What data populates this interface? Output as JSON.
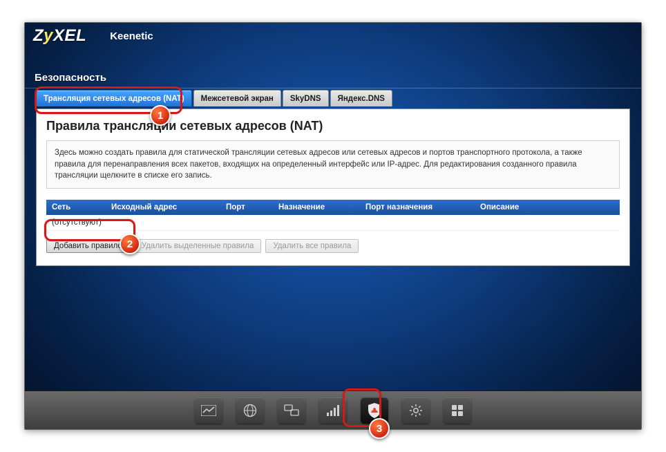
{
  "brand": {
    "prefix": "Z",
    "highlight": "y",
    "suffix": "XEL"
  },
  "device": "Keenetic",
  "section": "Безопасность",
  "tabs": [
    {
      "label": "Трансляция сетевых адресов (NAT)",
      "active": true
    },
    {
      "label": "Межсетевой экран",
      "active": false
    },
    {
      "label": "SkyDNS",
      "active": false
    },
    {
      "label": "Яндекс.DNS",
      "active": false
    }
  ],
  "page": {
    "title": "Правила трансляции сетевых адресов (NAT)",
    "info": "Здесь можно создать правила для статической трансляции сетевых адресов или сетевых адресов и портов транспортного протокола, а также правила для перенаправления всех пакетов, входящих на определенный интерфейс или IP-адрес. Для редактирования созданного правила трансляции щелкните в списке его запись."
  },
  "columns": [
    "Сеть",
    "Исходный адрес",
    "Порт",
    "Назначение",
    "Порт назначения",
    "Описание"
  ],
  "empty_row": "(отсутствуют)",
  "buttons": {
    "add": "Добавить правило",
    "del_selected": "Удалить выделенные правила",
    "del_all": "Удалить все правила"
  },
  "footer_icons": [
    "monitor",
    "globe",
    "devices",
    "wifi",
    "security",
    "settings",
    "apps"
  ],
  "callouts": [
    "1",
    "2",
    "3"
  ],
  "colors": {
    "accent": "#d81818",
    "header_grad_a": "#2f6fc9",
    "header_grad_b": "#1750a0"
  }
}
